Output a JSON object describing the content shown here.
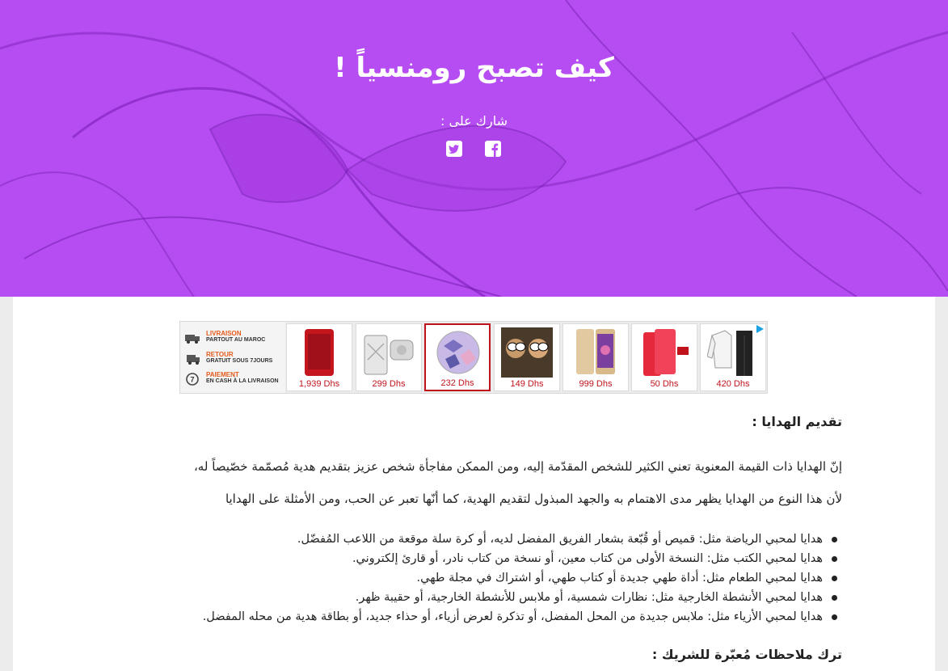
{
  "hero": {
    "title": "كيف تصبح رومنسياً !",
    "share_label": "شارك على :",
    "icons": [
      "facebook-icon",
      "twitter-icon"
    ],
    "bg_color": "#b64df2"
  },
  "ad": {
    "features": [
      {
        "title": "LIVRAISON",
        "subtitle": "PARTOUT AU MAROC",
        "icon": "truck-icon"
      },
      {
        "title": "RETOUR",
        "subtitle": "GRATUIT SOUS 7JOURS",
        "icon": "delivery-icon"
      },
      {
        "title": "PAIEMENT",
        "subtitle": "EN CASH À LA LIVRAISON",
        "icon": "seven-days-icon"
      }
    ],
    "products": [
      {
        "price": "1,939 Dhs",
        "item": "red-smartphone"
      },
      {
        "price": "299 Dhs",
        "item": "white-device"
      },
      {
        "price": "232 Dhs",
        "item": "phone-grip",
        "selected": true
      },
      {
        "price": "149 Dhs",
        "item": "sunglasses"
      },
      {
        "price": "999 Dhs",
        "item": "gold-smartphone"
      },
      {
        "price": "50 Dhs",
        "item": "red-phone"
      },
      {
        "price": "420 Dhs",
        "item": "tracksuit"
      }
    ],
    "accent": "#c0121b"
  },
  "article": {
    "heading1": "تقديم الهدايا :",
    "para1": "إنّ الهدايا ذات القيمة المعنوية تعني الكثير للشخص المقدّمة إليه، ومن الممكن مفاجأة شخص عزيز بتقديم هدية مُصمّمة خصّيصاً له،",
    "para2": "لأن هذا النوع من الهدايا يظهر مدى الاهتمام به والجهد المبذول لتقديم الهدية، كما أنّها تعبر عن الحب، ومن الأمثلة على الهدايا",
    "items": [
      "هدايا لمحبي الرياضة مثل: قميص أو قُبّعة بشعار الفريق المفضل لديه، أو كرة سلة موقعة من اللاعب المُفضّل.",
      "هدايا لمحبي الكتب مثل: النسخة الأولى من كتاب معين، أو نسخة من كتاب نادر، أو قارئ إلكتروني.",
      "هدايا لمحبي الطعام مثل: أداة طهي جديدة أو كتاب طهي، أو اشتراك في مجلة طهي.",
      "هدايا لمحبي الأنشطة الخارجية مثل: نظارات شمسية، أو ملابس للأنشطة الخارجية، أو حقيبة ظهر.",
      "هدايا لمحبي الأزياء مثل: ملابس جديدة من المحل المفضل، أو تذكرة لعرض أزياء، أو حذاء جديد، أو بطاقة هدية من محله المفضل."
    ],
    "heading2": "ترك ملاحظات مُعبّرة للشريك :"
  }
}
